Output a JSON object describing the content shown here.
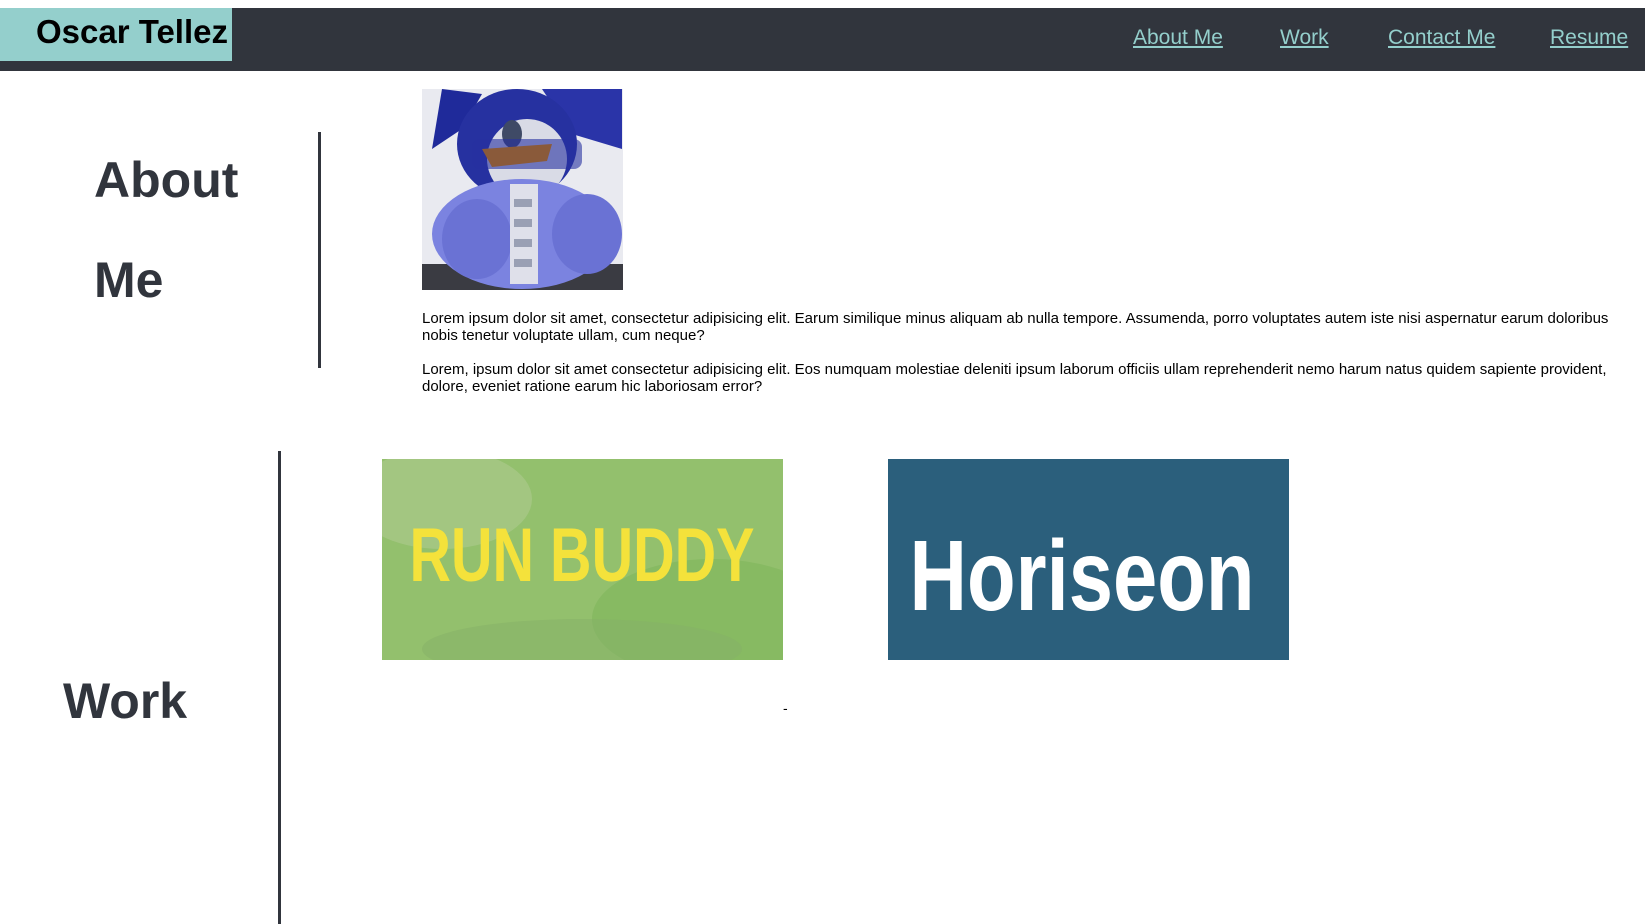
{
  "header": {
    "brand": "Oscar Tellez",
    "nav": [
      {
        "label": "About Me"
      },
      {
        "label": "Work"
      },
      {
        "label": "Contact Me"
      },
      {
        "label": "Resume"
      }
    ]
  },
  "about": {
    "title_line1": "About",
    "title_line2": "Me",
    "paragraphs": [
      "Lorem ipsum dolor sit amet, consectetur adipisicing elit. Earum similique minus aliquam ab nulla tempore. Assumenda, porro voluptates autem iste nisi aspernatur earum doloribus nobis tenetur voluptate ullam, cum neque?",
      "Lorem, ipsum dolor sit amet consectetur adipisicing elit. Eos numquam molestiae deleniti ipsum laborum officiis ullam reprehenderit nemo harum natus quidem sapiente provident, dolore, eveniet ratione earum hic laboriosam error?"
    ]
  },
  "work": {
    "title": "Work",
    "projects": [
      {
        "label": "RUN BUDDY",
        "text_color": "#f4e23b",
        "bg_color": "#93c06d"
      },
      {
        "label": "Horiseon",
        "text_color": "#ffffff",
        "bg_color": "#2b5f7c"
      }
    ],
    "stray_mark": "-"
  },
  "colors": {
    "header_bg": "#31353d",
    "accent": "#94cfcc",
    "heading": "#31353d"
  }
}
